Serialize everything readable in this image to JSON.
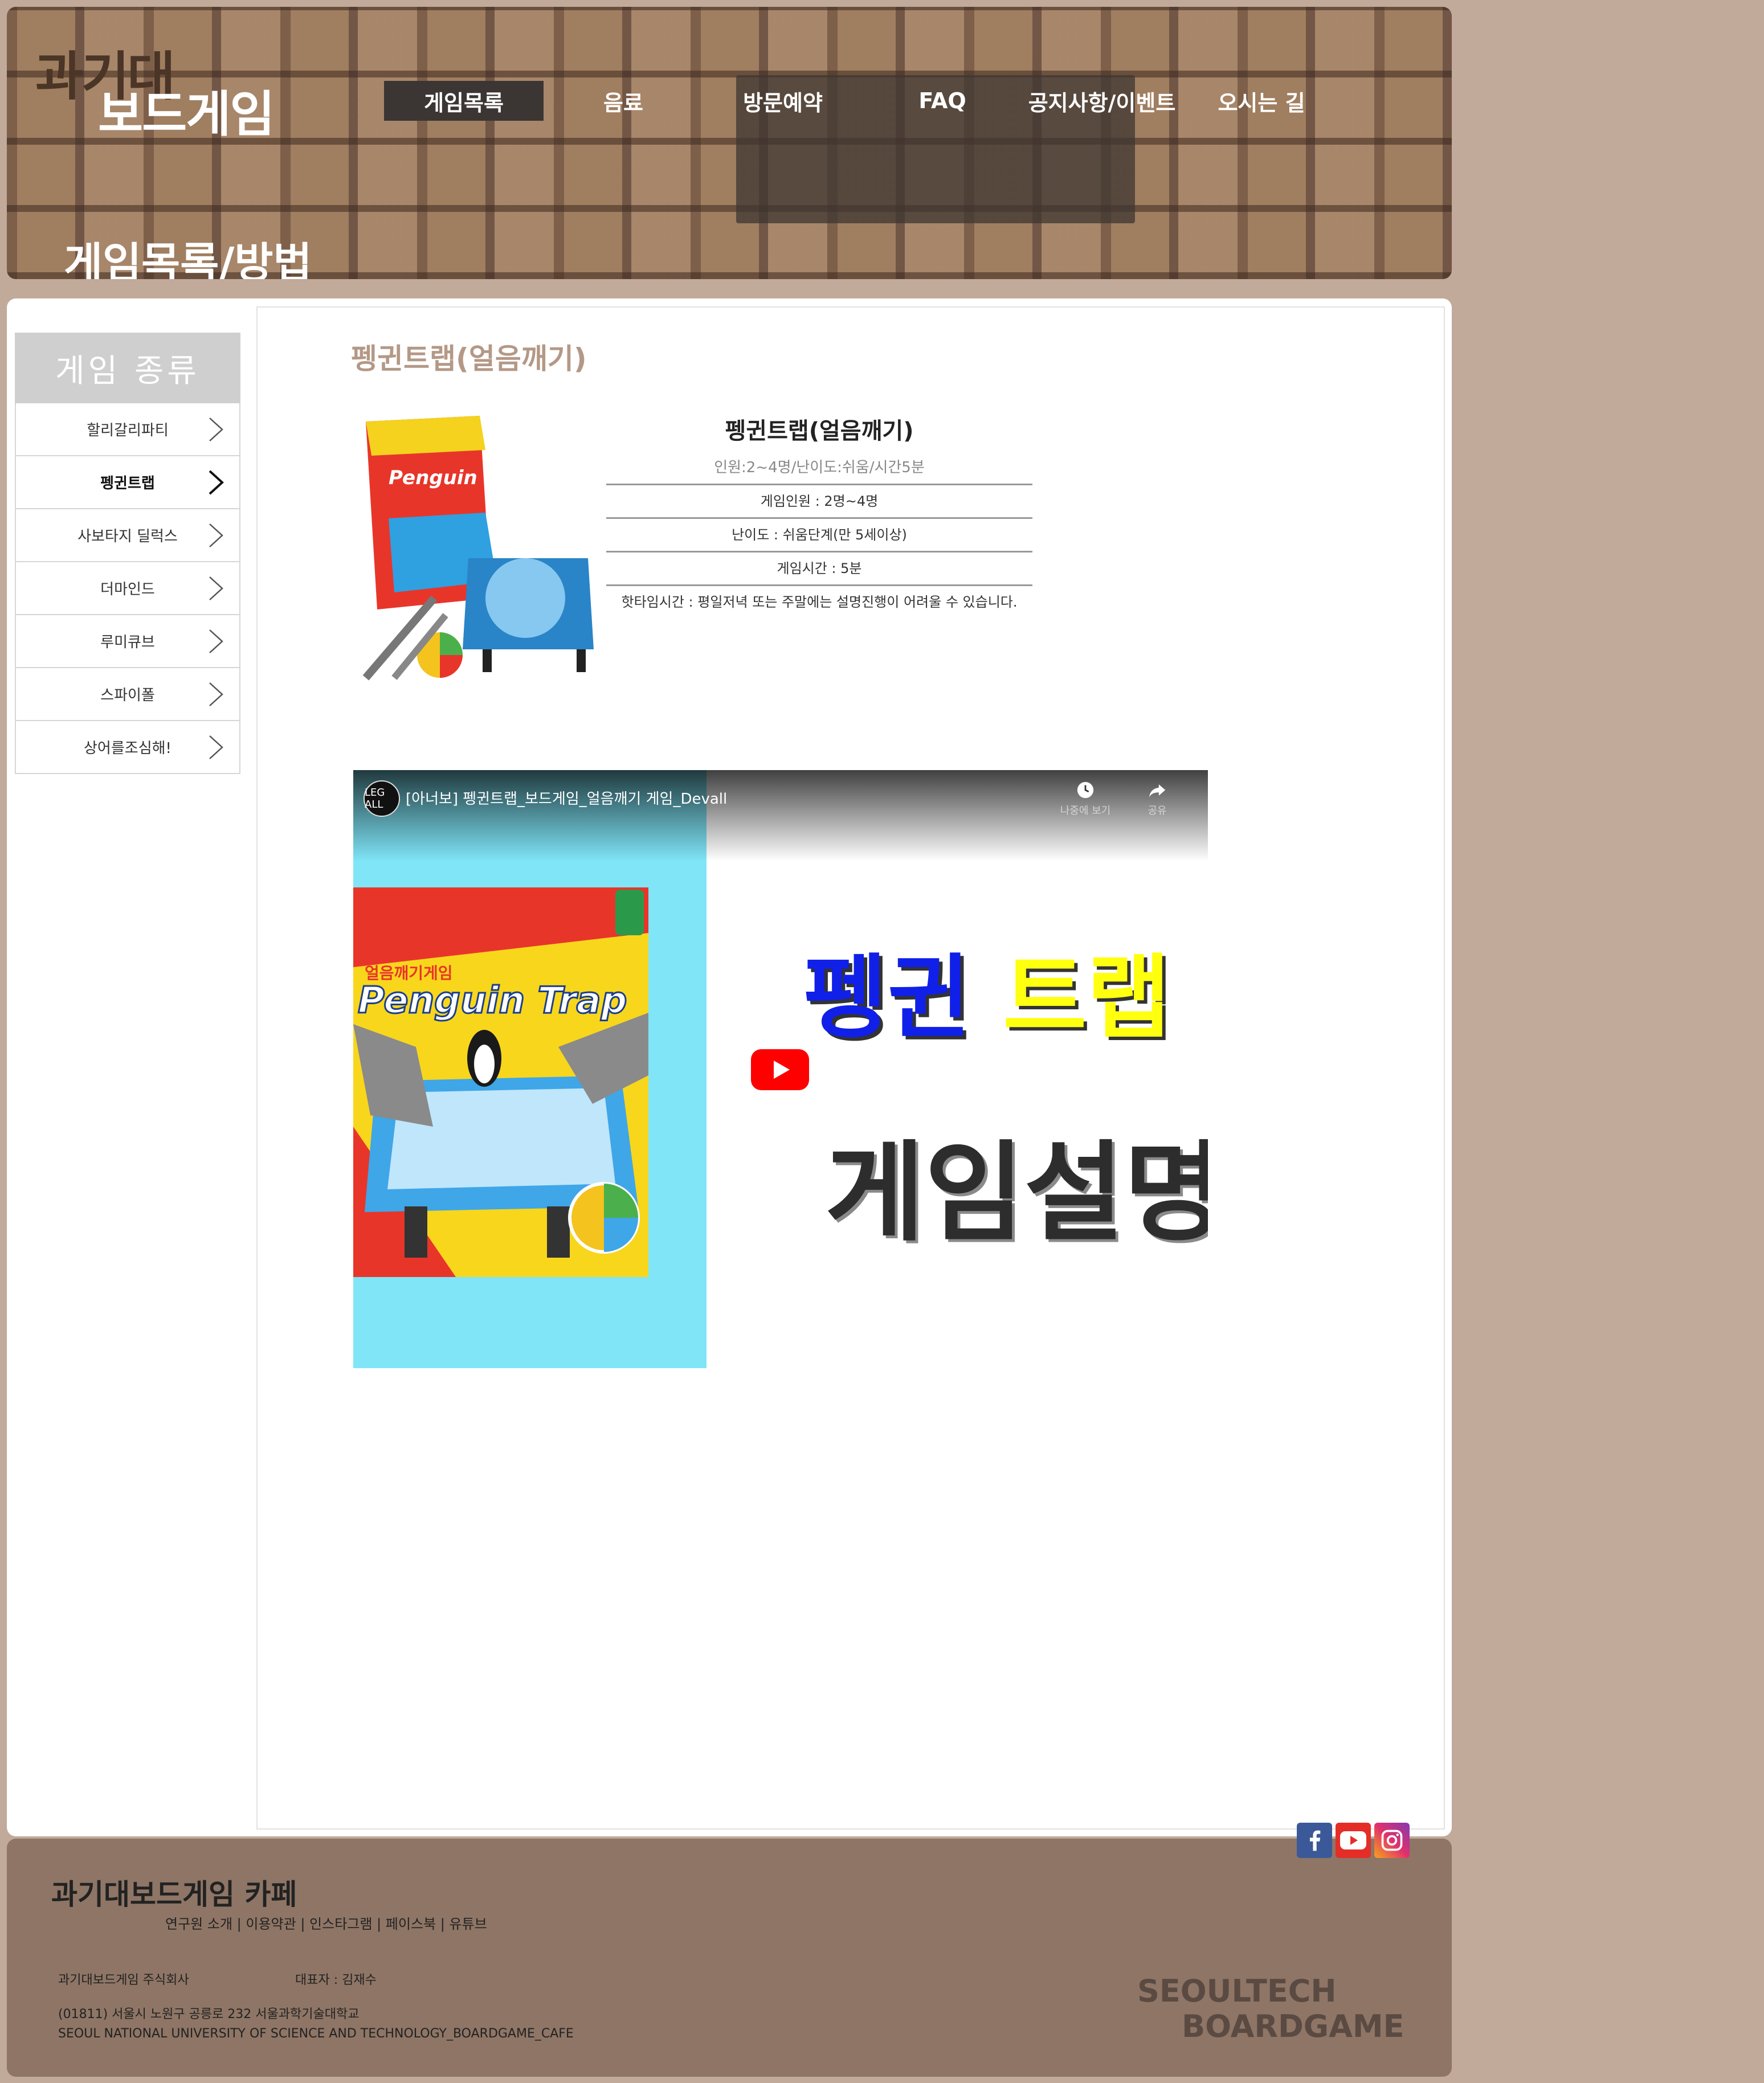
{
  "header": {
    "logo_line1": "과기대",
    "logo_line2": "보드게임",
    "nav": [
      "게임목록",
      "음료",
      "방문예약",
      "FAQ",
      "공지사항/이벤트",
      "오시는 길"
    ],
    "page_heading": "게임목록/방법"
  },
  "sidebar": {
    "title": "게임 종류",
    "items": [
      "할리갈리파티",
      "펭귄트랩",
      "사보타지 딜럭스",
      "더마인드",
      "루미큐브",
      "스파이폴",
      "상어를조심해!"
    ]
  },
  "game": {
    "page_title": "펭귄트랩(얼음깨기)",
    "name": "펭귄트랩(얼음깨기)",
    "summary": "인원:2~4명/난이도:쉬움/시간5분",
    "players": "게임인원 : 2명~4명",
    "difficulty": "난이도 : 쉬움단계(만 5세이상)",
    "time": "게임시간 : 5분",
    "note": "핫타임시간 : 평일저녁 또는 주말에는 설명진행이 어려울 수 있습니다."
  },
  "video": {
    "channel_avatar": "LEG ALL",
    "title": "[아너보] 펭귄트랩_보드게임_얼음깨기 게임_Devall",
    "watch_later": "나중에 보기",
    "share": "공유",
    "thumb_word1": "펭귄",
    "thumb_word2": "트랩",
    "thumb_line2": "게임설명",
    "box_title": "Penguin Trap",
    "box_subtitle": "얼음깨기게임"
  },
  "footer": {
    "brand": "과기대보드게임 카페",
    "links": "연구원 소개 | 이용약관 | 인스타그램 | 페이스북 | 유튜브",
    "company": "과기대보드게임 주식회사",
    "ceo": "대표자 : 김재수",
    "address": "(01811) 서울시 노원구 공릉로 232 서울과학기술대학교",
    "address_en": "SEOUL NATIONAL UNIVERSITY OF SCIENCE AND TECHNOLOGY_BOARDGAME_CAFE",
    "logo_line1": "SEOULTECH",
    "logo_line2": "BOARDGAME"
  },
  "social": [
    "facebook-icon",
    "youtube-icon",
    "instagram-icon"
  ],
  "colors": {
    "page_bg": "#c1aa9a",
    "footer_bg": "#8e7565",
    "accent_title": "#b49886",
    "nav_active": "#3b3634"
  }
}
